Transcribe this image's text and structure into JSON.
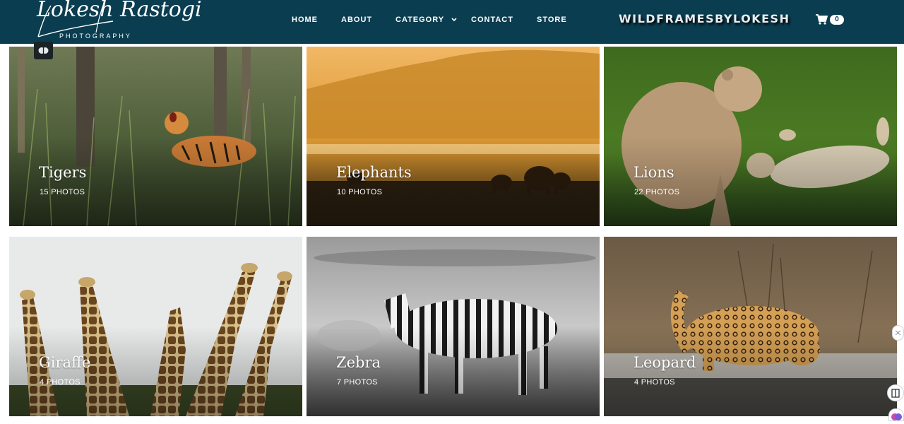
{
  "header": {
    "logo_name": "Lokesh Rastogi",
    "logo_tagline": "PHOTOGRAPHY",
    "nav": [
      {
        "label": "HOME"
      },
      {
        "label": "ABOUT"
      },
      {
        "label": "CATEGORY"
      },
      {
        "label": "CONTACT"
      },
      {
        "label": "STORE"
      }
    ],
    "brand": "WILDFRAMESBYLOKESH",
    "cart_count": "0",
    "colors": {
      "header_bg": "#0a3d50",
      "text": "#ffffff"
    }
  },
  "gallery": {
    "categories": [
      {
        "title": "Tigers",
        "count": "15 PHOTOS"
      },
      {
        "title": "Elephants",
        "count": "10 PHOTOS"
      },
      {
        "title": "Lions",
        "count": "22 PHOTOS"
      },
      {
        "title": "Giraffe",
        "count": "4 PHOTOS"
      },
      {
        "title": "Zebra",
        "count": "7 PHOTOS"
      },
      {
        "title": "Leopard",
        "count": "4 PHOTOS"
      }
    ]
  },
  "icons": {
    "cart": "shopping-cart-icon",
    "chevron": "chevron-down-icon",
    "overlay": "brain-icon"
  }
}
